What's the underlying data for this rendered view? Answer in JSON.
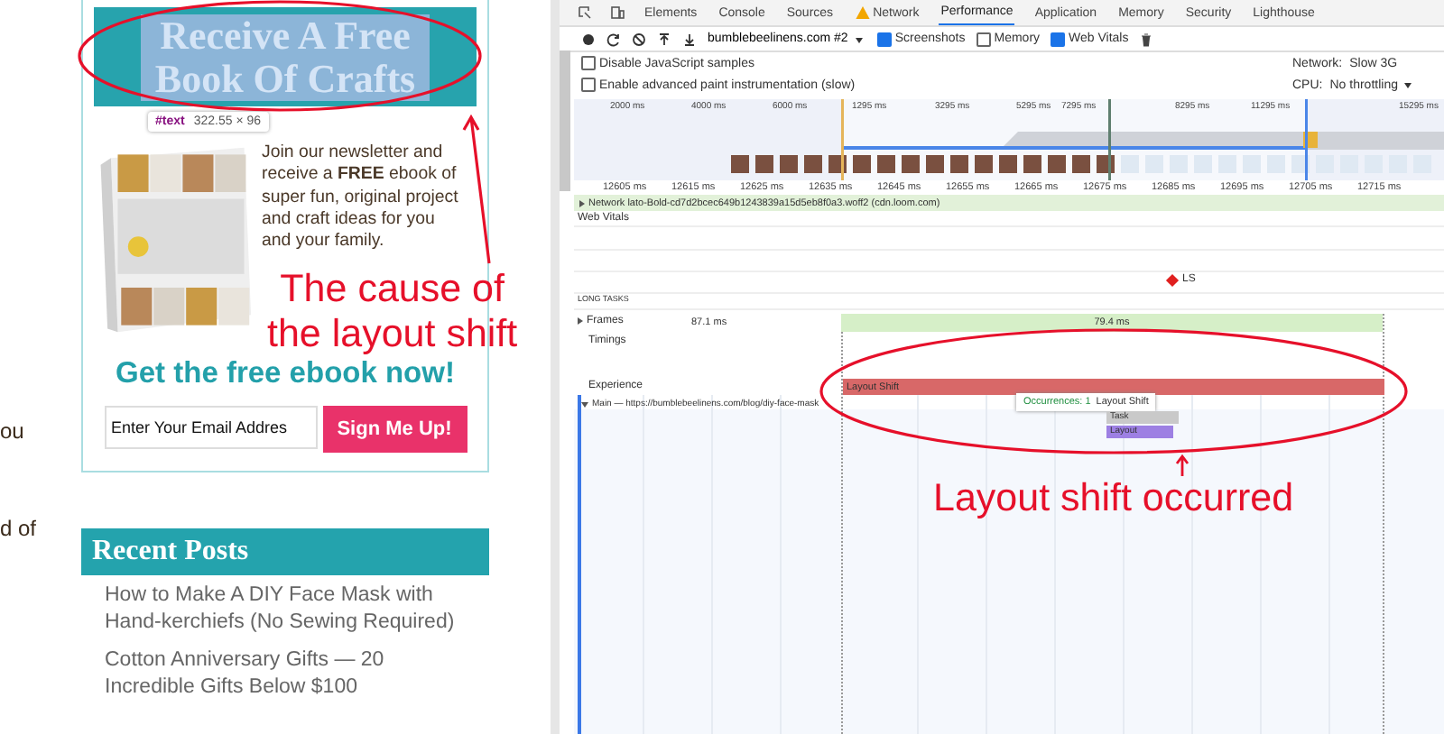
{
  "page": {
    "edge_texts": [
      "ou",
      "d of"
    ],
    "signup": {
      "title": "Receive A Free Book Of Crafts",
      "highlighted": true,
      "inspector_tag": "#text",
      "inspector_size": "322.55 × 96",
      "body": "Join our newsletter and receive a **FREE** ebook of super fun, original project and craft ideas for you and your family.",
      "cta": "Get the free ebook now!",
      "email": {
        "placeholder": "Enter Your Email Addres"
      },
      "button": "Sign Me Up!"
    },
    "recent_posts": {
      "title": "Recent Posts",
      "posts": [
        "How to Make A DIY Face Mask with Hand-kerchiefs (No Sewing Required)",
        "Cotton Anniversary Gifts — 20 Incredible Gifts Below $100"
      ]
    }
  },
  "devtools": {
    "tabs": [
      {
        "label": "Elements",
        "selected": false,
        "warning": false
      },
      {
        "label": "Console",
        "selected": false,
        "warning": false
      },
      {
        "label": "Sources",
        "selected": false,
        "warning": false
      },
      {
        "label": "Network",
        "selected": false,
        "warning": true
      },
      {
        "label": "Performance",
        "selected": true,
        "warning": false
      },
      {
        "label": "Application",
        "selected": false,
        "warning": false
      },
      {
        "label": "Memory",
        "selected": false,
        "warning": false
      },
      {
        "label": "Security",
        "selected": false,
        "warning": false
      },
      {
        "label": "Lighthouse",
        "selected": false,
        "warning": false
      }
    ],
    "profile": "bumblebeelinens.com #2",
    "toolbar_checks": [
      {
        "label": "Screenshots",
        "checked": true
      },
      {
        "label": "Memory",
        "checked": false
      },
      {
        "label": "Web Vitals",
        "checked": true
      }
    ],
    "settings": [
      {
        "label": "Disable JavaScript samples",
        "checked": false,
        "key": "Network:",
        "value": "Slow 3G",
        "dropdown": false
      },
      {
        "label": "Enable advanced paint instrumentation (slow)",
        "checked": false,
        "key": "CPU:",
        "value": "No throttling",
        "dropdown": true
      }
    ],
    "overview_ticks": [
      "2000 ms",
      "4000 ms",
      "6000 ms",
      "1295 ms",
      "3295 ms",
      "5295 ms",
      "7295 ms",
      "8295 ms",
      "11295 ms",
      "15295 ms"
    ],
    "ruler_ticks": [
      "12605 ms",
      "12615 ms",
      "12625 ms",
      "12635 ms",
      "12645 ms",
      "12655 ms",
      "12665 ms",
      "12675 ms",
      "12685 ms",
      "12695 ms",
      "12705 ms",
      "12715 ms"
    ],
    "network_row": "Network lato-Bold-cd7d2bcec649b1243839a15d5eb8f0a3.woff2 (cdn.loom.com)",
    "web_vitals": "Web Vitals",
    "ls_marker": "LS",
    "long_tasks": "LONG TASKS",
    "frames": {
      "label": "Frames",
      "times": [
        "87.1 ms",
        "79.4 ms"
      ]
    },
    "timings": "Timings",
    "experience": "Experience",
    "layout_shift_bar": "Layout Shift",
    "tooltip": {
      "label": "Occurrences: 1",
      "text": "Layout Shift"
    },
    "main_row": "Main — https://bumblebeelinens.com/blog/diy-face-mask",
    "task": "Task",
    "layout": "Layout"
  },
  "annotations": [
    {
      "lines": [
        "The cause of",
        "the layout shift"
      ]
    },
    {
      "lines": [
        "Layout shift occurred"
      ]
    }
  ]
}
